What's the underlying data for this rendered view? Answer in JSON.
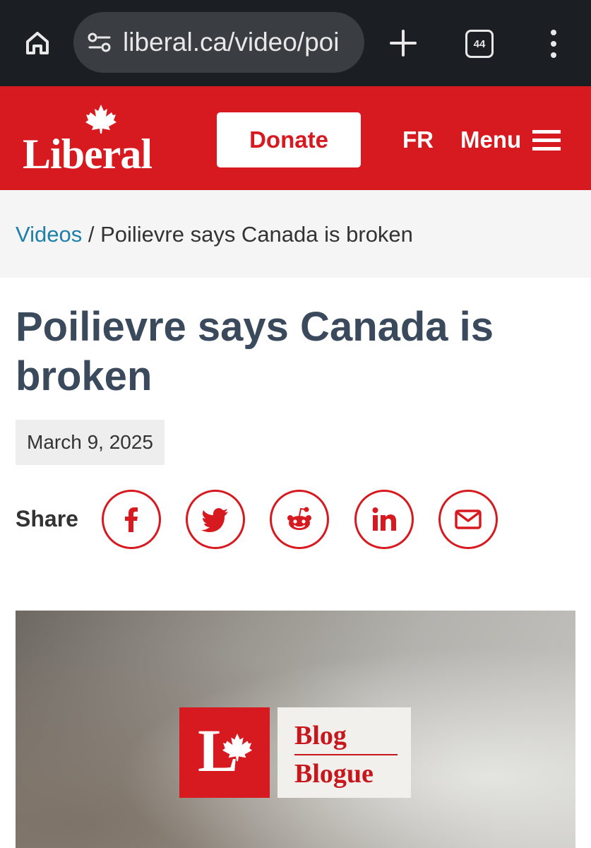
{
  "browser": {
    "url": "liberal.ca/video/poi",
    "tab_count": "44"
  },
  "header": {
    "logo_text": "Liberal",
    "donate_label": "Donate",
    "language_label": "FR",
    "menu_label": "Menu"
  },
  "breadcrumb": {
    "parent": "Videos",
    "separator": " / ",
    "current": "Poilievre says Canada is broken"
  },
  "article": {
    "title": "Poilievre says Canada is broken",
    "date": "March 9, 2025"
  },
  "share": {
    "label": "Share",
    "buttons": [
      "facebook-icon",
      "twitter-icon",
      "reddit-icon",
      "linkedin-icon",
      "email-icon"
    ]
  },
  "video": {
    "logo_letter": "L",
    "blog_en": "Blog",
    "blog_fr": "Blogue"
  },
  "colors": {
    "brand_red": "#d71920",
    "title": "#3a4a5c",
    "link": "#1e7fa8"
  }
}
